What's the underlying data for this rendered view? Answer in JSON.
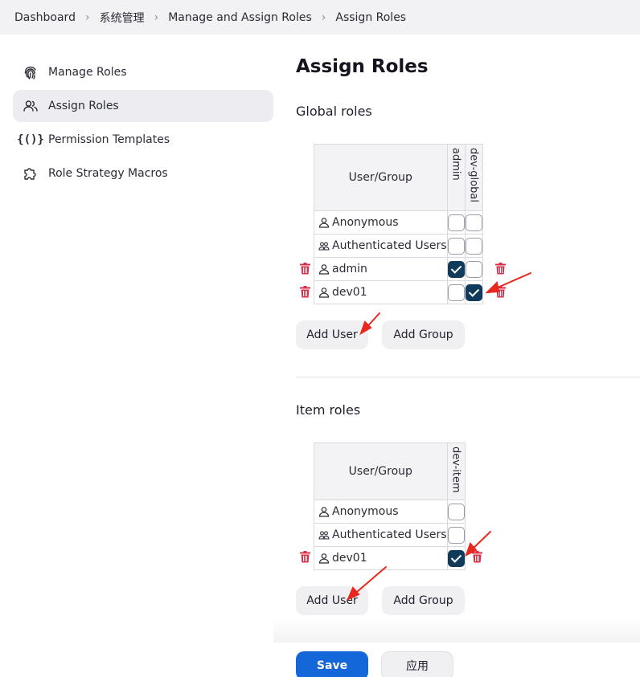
{
  "breadcrumb": [
    "Dashboard",
    "系统管理",
    "Manage and Assign Roles",
    "Assign Roles"
  ],
  "sidebar": {
    "items": [
      {
        "label": "Manage Roles",
        "icon": "fingerprint-icon"
      },
      {
        "label": "Assign Roles",
        "icon": "users-icon",
        "active": true
      },
      {
        "label": "Permission Templates",
        "icon": "braces-icon"
      },
      {
        "label": "Role Strategy Macros",
        "icon": "puzzle-icon"
      }
    ]
  },
  "main": {
    "title": "Assign Roles",
    "global": {
      "title": "Global roles",
      "header": "User/Group",
      "roles": [
        "admin",
        "dev-global"
      ],
      "rows": [
        {
          "name": "Anonymous",
          "type": "user",
          "checks": [
            false,
            false
          ],
          "deletable": false
        },
        {
          "name": "Authenticated Users",
          "type": "group",
          "checks": [
            false,
            false
          ],
          "deletable": false
        },
        {
          "name": "admin",
          "type": "user",
          "checks": [
            true,
            false
          ],
          "deletable": true
        },
        {
          "name": "dev01",
          "type": "user",
          "checks": [
            false,
            true
          ],
          "deletable": true
        }
      ],
      "add_user": "Add User",
      "add_group": "Add Group"
    },
    "item": {
      "title": "Item roles",
      "header": "User/Group",
      "roles": [
        "dev-item"
      ],
      "rows": [
        {
          "name": "Anonymous",
          "type": "user",
          "checks": [
            false
          ],
          "deletable": false
        },
        {
          "name": "Authenticated Users",
          "type": "group",
          "checks": [
            false
          ],
          "deletable": false
        },
        {
          "name": "dev01",
          "type": "user",
          "checks": [
            true
          ],
          "deletable": true
        }
      ],
      "add_user": "Add User",
      "add_group": "Add Group"
    }
  },
  "footer": {
    "save": "Save",
    "apply": "应用"
  },
  "colors": {
    "accent": "#1467d8",
    "checked": "#0f3a5c",
    "delete": "#d9304a",
    "annotation_arrow": "#e8281e"
  }
}
